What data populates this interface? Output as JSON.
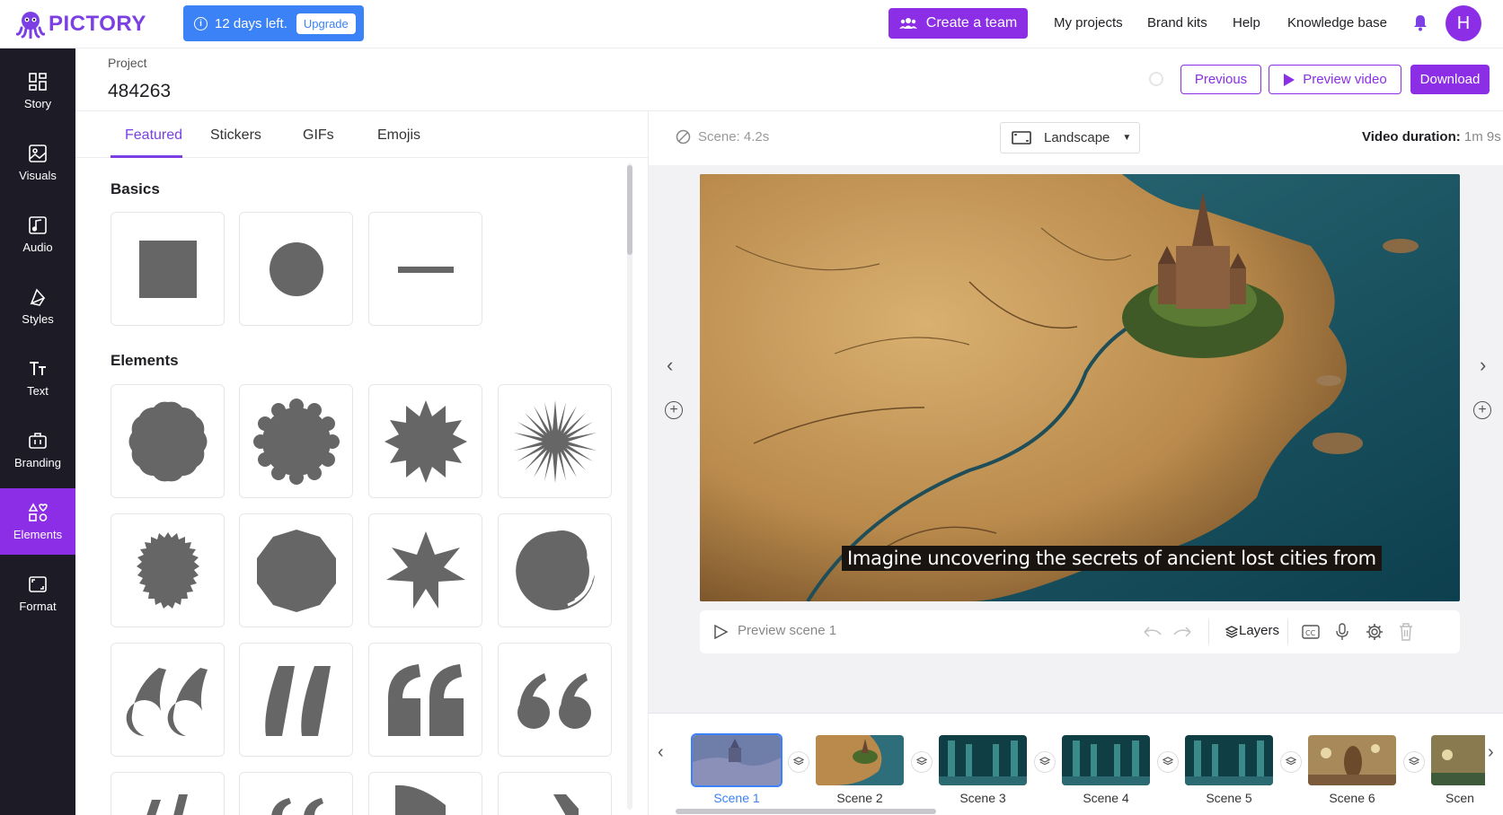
{
  "brand": {
    "name": "PICTORY",
    "color": "#7b3fe4"
  },
  "trial": {
    "text": "12 days left.",
    "upgrade_label": "Upgrade"
  },
  "topnav": {
    "create_team": "Create a team",
    "my_projects": "My projects",
    "brand_kits": "Brand kits",
    "help": "Help",
    "knowledge_base": "Knowledge base",
    "avatar_initial": "H"
  },
  "sidebar": {
    "items": [
      {
        "label": "Story",
        "icon": "grid-icon"
      },
      {
        "label": "Visuals",
        "icon": "image-icon"
      },
      {
        "label": "Audio",
        "icon": "music-icon"
      },
      {
        "label": "Styles",
        "icon": "styles-icon"
      },
      {
        "label": "Text",
        "icon": "text-icon"
      },
      {
        "label": "Branding",
        "icon": "briefcase-icon"
      },
      {
        "label": "Elements",
        "icon": "elements-icon",
        "active": true
      },
      {
        "label": "Format",
        "icon": "format-icon"
      }
    ]
  },
  "project": {
    "label": "Project",
    "name": "484263",
    "previous": "Previous",
    "preview_video": "Preview video",
    "download": "Download"
  },
  "panel": {
    "tabs": [
      "Featured",
      "Stickers",
      "GIFs",
      "Emojis"
    ],
    "active_tab": "Featured",
    "sections": {
      "basics": "Basics",
      "elements": "Elements"
    }
  },
  "editor": {
    "scene_duration": "Scene: 4.2s",
    "orientation": "Landscape",
    "video_duration_label": "Video duration:",
    "video_duration_value": "1m 9s",
    "caption": "Imagine uncovering the secrets of ancient lost cities from",
    "preview_scene": "Preview scene 1",
    "layers": "Layers"
  },
  "timeline": {
    "scenes": [
      "Scene 1",
      "Scene 2",
      "Scene 3",
      "Scene 4",
      "Scene 5",
      "Scene 6",
      "Scen"
    ],
    "active_scene": "Scene 1"
  },
  "colors": {
    "accent": "#8b2ee6",
    "info": "#3b82f6",
    "sidebar": "#1d1b26"
  }
}
